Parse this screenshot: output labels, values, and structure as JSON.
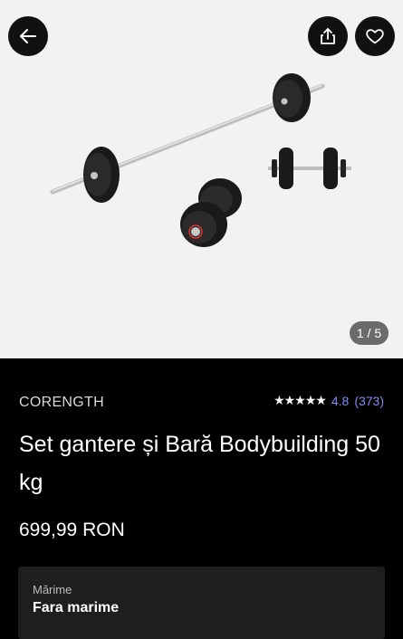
{
  "gallery": {
    "counter": "1 / 5",
    "image_alt": "Barbell and dumbbell set"
  },
  "icons": {
    "back": "arrow-left-icon",
    "share": "share-icon",
    "favorite": "heart-icon",
    "rating": "star-icon"
  },
  "product": {
    "brand": "CORENGTH",
    "stars": "★★★★★",
    "rating": "4.8",
    "review_count": "(373)",
    "title": "Set gantere și Bară Bodybuilding 50 kg",
    "price": "699,99 RON"
  },
  "size": {
    "label": "Mărime",
    "value": "Fara marime"
  },
  "colors": {
    "rating_accent": "#7d8ff0",
    "gallery_bg": "#f2f2f2",
    "page_bg": "#000000"
  }
}
